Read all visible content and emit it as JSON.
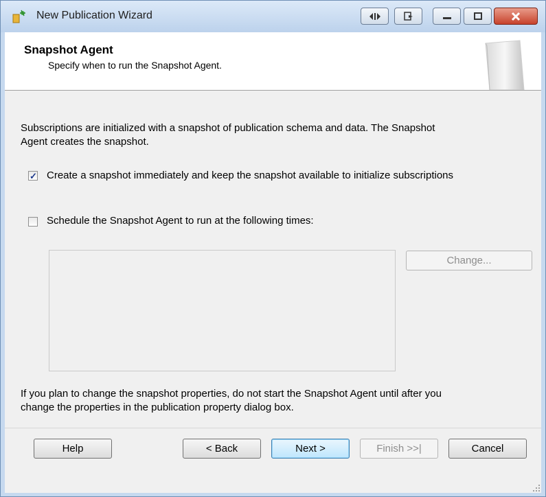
{
  "window": {
    "title": "New Publication Wizard"
  },
  "header": {
    "title": "Snapshot Agent",
    "subtitle": "Specify when to run the Snapshot Agent."
  },
  "body": {
    "intro_line1": "Subscriptions are initialized with a snapshot of publication schema and data. The Snapshot",
    "intro_line2": "Agent creates the snapshot.",
    "option_immediate": {
      "label": "Create a snapshot immediately and keep the snapshot available to initialize subscriptions",
      "checked": true
    },
    "option_schedule": {
      "label": "Schedule the Snapshot Agent to run at the following times:",
      "checked": false
    },
    "change_button": "Change...",
    "note_line1": "If you plan to change the snapshot properties, do not start the Snapshot Agent until after you",
    "note_line2": "change the properties in the publication property dialog box."
  },
  "footer": {
    "help": "Help",
    "back": "< Back",
    "next": "Next >",
    "finish": "Finish >>|",
    "cancel": "Cancel"
  },
  "icons": [
    "wizard-icon",
    "back-forward-icon",
    "copy-icon",
    "minimize-icon",
    "maximize-icon",
    "close-icon",
    "wizard-header-graphic",
    "resize-grip-icon"
  ]
}
